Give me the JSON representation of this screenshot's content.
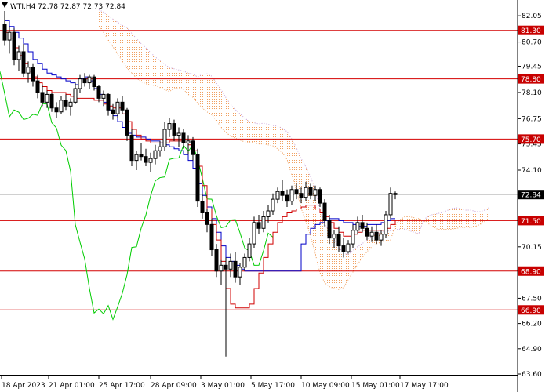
{
  "chart_data": {
    "type": "candlestick",
    "title": "WTI,H4  72.78 72.87 72.73 72.84",
    "symbol": "WTI",
    "timeframe": "H4",
    "ohlc": [
      72.78,
      72.87,
      72.73,
      72.84
    ],
    "current_price": "72.84",
    "y_range": [
      63.6,
      82.5
    ],
    "y_ticks": [
      "82.05",
      "80.70",
      "79.45",
      "78.10",
      "76.75",
      "75.45",
      "74.10",
      "72.75",
      "71.40",
      "70.15",
      "68.80",
      "67.50",
      "66.20",
      "64.90",
      "63.60"
    ],
    "x_ticks": [
      "18 Apr 2023",
      "21 Apr 01:00",
      "25 Apr 17:00",
      "28 Apr 09:00",
      "3 May 01:00",
      "5 May 17:00",
      "10 May 09:00",
      "15 May 01:00",
      "17 May 17:00"
    ],
    "levels": [
      {
        "label": "81.30",
        "value": 81.3
      },
      {
        "label": "78.80",
        "value": 78.8
      },
      {
        "label": "75.70",
        "value": 75.7
      },
      {
        "label": "71.50",
        "value": 71.5
      },
      {
        "label": "68.90",
        "value": 68.9
      },
      {
        "label": "66.90",
        "value": 66.9
      }
    ],
    "colors": {
      "level_line": "#d40000",
      "level_badge": "#c80000",
      "tenkan": "#0000c8",
      "kijun": "#d00000",
      "chikou": "#00cc00",
      "cloud_a": "#f0a060",
      "cloud_b": "#c8a0d8",
      "candle": "#000000",
      "current_price_badge": "#000000"
    },
    "candles": [
      [
        81.6,
        82.3,
        80.5,
        80.8
      ],
      [
        80.8,
        81.5,
        80.1,
        81.2
      ],
      [
        81.2,
        81.4,
        79.5,
        79.8
      ],
      [
        79.8,
        80.5,
        79.2,
        80.2
      ],
      [
        80.2,
        80.6,
        78.9,
        79.1
      ],
      [
        79.1,
        79.7,
        78.6,
        79.4
      ],
      [
        79.4,
        79.6,
        78.4,
        78.7
      ],
      [
        78.7,
        79.0,
        77.8,
        78.1
      ],
      [
        78.1,
        78.5,
        77.4,
        77.6
      ],
      [
        77.6,
        78.2,
        77.3,
        78.0
      ],
      [
        78.0,
        78.1,
        77.1,
        77.3
      ],
      [
        77.3,
        77.6,
        76.8,
        77.1
      ],
      [
        77.1,
        77.9,
        77.0,
        77.7
      ],
      [
        77.7,
        78.0,
        77.2,
        77.4
      ],
      [
        77.4,
        77.8,
        76.9,
        77.6
      ],
      [
        77.6,
        78.6,
        77.5,
        78.3
      ],
      [
        78.3,
        79.0,
        78.1,
        78.8
      ],
      [
        78.8,
        79.1,
        78.4,
        78.6
      ],
      [
        78.6,
        79.0,
        78.3,
        78.9
      ],
      [
        78.9,
        79.0,
        78.2,
        78.4
      ],
      [
        78.4,
        78.5,
        77.6,
        77.8
      ],
      [
        77.8,
        78.2,
        77.4,
        78.0
      ],
      [
        78.0,
        78.1,
        76.9,
        77.2
      ],
      [
        77.2,
        77.5,
        76.7,
        77.0
      ],
      [
        77.0,
        77.8,
        76.8,
        77.6
      ],
      [
        77.6,
        77.9,
        77.0,
        77.2
      ],
      [
        77.2,
        77.3,
        75.6,
        75.9
      ],
      [
        75.9,
        76.2,
        74.3,
        74.6
      ],
      [
        74.6,
        75.1,
        74.1,
        74.9
      ],
      [
        74.9,
        75.5,
        74.6,
        74.8
      ],
      [
        74.8,
        75.2,
        74.3,
        74.5
      ],
      [
        74.5,
        75.0,
        74.0,
        74.7
      ],
      [
        74.7,
        75.4,
        74.4,
        75.1
      ],
      [
        75.1,
        75.6,
        74.8,
        75.3
      ],
      [
        75.3,
        76.6,
        75.1,
        76.2
      ],
      [
        76.2,
        76.8,
        75.8,
        76.5
      ],
      [
        76.5,
        76.7,
        75.6,
        75.9
      ],
      [
        75.9,
        76.3,
        75.3,
        76.0
      ],
      [
        76.0,
        76.2,
        75.2,
        75.5
      ],
      [
        75.5,
        75.9,
        74.9,
        75.6
      ],
      [
        75.6,
        75.8,
        74.6,
        74.9
      ],
      [
        74.9,
        75.2,
        72.2,
        72.5
      ],
      [
        72.5,
        72.9,
        71.6,
        71.9
      ],
      [
        71.9,
        72.1,
        70.9,
        71.3
      ],
      [
        71.3,
        71.6,
        69.7,
        70.0
      ],
      [
        70.0,
        70.3,
        68.6,
        68.9
      ],
      [
        68.9,
        69.5,
        68.2,
        69.2
      ],
      [
        69.2,
        69.6,
        64.5,
        69.0
      ],
      [
        69.0,
        69.8,
        68.6,
        69.4
      ],
      [
        69.4,
        69.9,
        68.3,
        68.6
      ],
      [
        68.6,
        69.3,
        68.2,
        69.1
      ],
      [
        69.1,
        69.8,
        68.9,
        69.6
      ],
      [
        69.6,
        70.6,
        69.4,
        70.3
      ],
      [
        70.3,
        71.7,
        70.1,
        71.4
      ],
      [
        71.4,
        71.8,
        70.8,
        71.1
      ],
      [
        71.1,
        72.0,
        70.9,
        71.7
      ],
      [
        71.7,
        72.3,
        71.4,
        72.0
      ],
      [
        72.0,
        72.9,
        71.8,
        72.6
      ],
      [
        72.6,
        73.2,
        72.4,
        73.0
      ],
      [
        73.0,
        73.6,
        72.5,
        72.8
      ],
      [
        72.8,
        73.1,
        72.2,
        72.5
      ],
      [
        72.5,
        73.3,
        72.3,
        73.1
      ],
      [
        73.1,
        73.4,
        72.6,
        72.9
      ],
      [
        72.9,
        73.2,
        72.4,
        72.7
      ],
      [
        72.7,
        73.5,
        72.5,
        73.2
      ],
      [
        73.2,
        73.4,
        72.6,
        72.8
      ],
      [
        72.8,
        73.3,
        72.5,
        73.1
      ],
      [
        73.1,
        73.2,
        72.2,
        72.4
      ],
      [
        72.4,
        72.6,
        71.2,
        71.5
      ],
      [
        71.5,
        71.8,
        70.3,
        70.6
      ],
      [
        70.6,
        71.0,
        70.1,
        70.8
      ],
      [
        70.8,
        71.2,
        69.9,
        70.2
      ],
      [
        70.2,
        70.6,
        69.6,
        69.9
      ],
      [
        69.9,
        70.5,
        69.8,
        70.3
      ],
      [
        70.3,
        71.3,
        70.1,
        71.0
      ],
      [
        71.0,
        71.7,
        70.8,
        71.4
      ],
      [
        71.4,
        71.8,
        70.9,
        71.1
      ],
      [
        71.1,
        71.4,
        70.5,
        70.7
      ],
      [
        70.7,
        71.2,
        70.4,
        70.9
      ],
      [
        70.9,
        71.3,
        70.3,
        70.5
      ],
      [
        70.5,
        71.0,
        70.2,
        70.8
      ],
      [
        70.8,
        72.0,
        70.6,
        71.8
      ],
      [
        71.8,
        73.2,
        71.6,
        72.9
      ],
      [
        72.9,
        73.0,
        72.6,
        72.84
      ]
    ],
    "tenkan": [
      81.8,
      81.5,
      81.2,
      80.9,
      80.6,
      80.2,
      79.8,
      79.6,
      79.3,
      79.1,
      79.0,
      78.9,
      78.8,
      78.7,
      78.6,
      78.5,
      78.8,
      78.9,
      78.7,
      78.3,
      78.0,
      77.6,
      77.2,
      76.9,
      76.6,
      76.3,
      76.0,
      75.9,
      75.8,
      75.8,
      75.7,
      75.6,
      75.6,
      75.5,
      75.4,
      75.3,
      75.2,
      75.1,
      74.9,
      74.6,
      74.2,
      73.4,
      72.8,
      72.2,
      71.6,
      70.9,
      70.2,
      69.6,
      69.4,
      69.2,
      69.0,
      68.9,
      68.9,
      68.9,
      68.9,
      68.9,
      68.9,
      68.9,
      68.9,
      68.9,
      68.9,
      68.9,
      68.9,
      70.3,
      70.8,
      71.1,
      71.3,
      71.4,
      71.5,
      71.6,
      71.6,
      71.5,
      71.4,
      71.4,
      71.3,
      71.2,
      71.2,
      71.3,
      71.3,
      71.3,
      71.4,
      71.5,
      71.6,
      71.6
    ],
    "kijun": [
      81.2,
      80.9,
      80.4,
      80.0,
      79.6,
      79.2,
      78.9,
      78.6,
      78.4,
      78.2,
      78.1,
      78.1,
      78.1,
      78.0,
      77.9,
      77.8,
      77.8,
      77.8,
      77.8,
      77.7,
      77.7,
      77.5,
      77.4,
      77.3,
      77.3,
      77.0,
      76.6,
      76.2,
      75.9,
      75.7,
      75.6,
      75.5,
      75.5,
      75.5,
      75.5,
      75.6,
      75.6,
      75.6,
      75.5,
      75.4,
      75.1,
      74.3,
      73.3,
      72.1,
      71.3,
      70.5,
      69.4,
      68.0,
      67.2,
      67.0,
      67.0,
      67.0,
      67.2,
      68.0,
      68.8,
      69.6,
      70.3,
      70.9,
      71.4,
      71.7,
      71.9,
      72.0,
      72.1,
      72.2,
      72.3,
      72.3,
      72.1,
      71.9,
      71.7,
      71.4,
      71.1,
      70.9,
      70.7,
      70.7,
      70.8,
      70.9,
      71.0,
      71.0,
      71.0,
      71.0,
      71.0,
      71.1,
      71.3,
      71.5
    ]
  }
}
